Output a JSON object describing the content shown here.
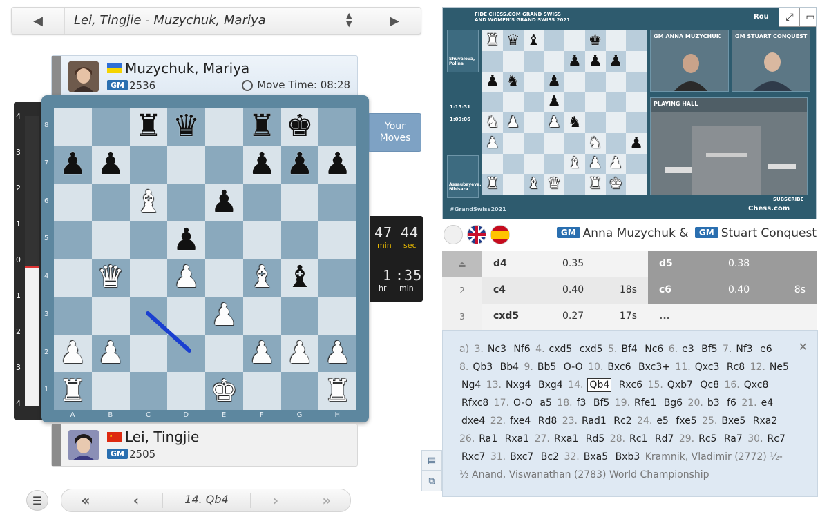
{
  "game_bar": {
    "title": "Lei, Tingjie - Muzychuk, Mariya",
    "prev_icon": "triangle-left",
    "next_icon": "triangle-right",
    "sort_icon": "updown-arrows"
  },
  "top_player": {
    "name": "Muzychuk, Mariya",
    "title": "GM",
    "rating": "2536",
    "move_time_label": "Move Time: 08:28",
    "flag": "ukraine"
  },
  "bottom_player": {
    "name": "Lei, Tingjie",
    "title": "GM",
    "rating": "2505",
    "flag": "china"
  },
  "eval_bar": {
    "ticks": [
      "4",
      "3",
      "2",
      "1",
      "0",
      "1",
      "2",
      "3",
      "4"
    ],
    "white_advantage": 0.0
  },
  "board": {
    "files": [
      "A",
      "B",
      "C",
      "D",
      "E",
      "F",
      "G",
      "H"
    ],
    "ranks": [
      "8",
      "7",
      "6",
      "5",
      "4",
      "3",
      "2",
      "1"
    ],
    "rows": [
      [
        "",
        "",
        "br",
        "bq",
        "",
        "br",
        "bk",
        ""
      ],
      [
        "bp",
        "bp",
        "",
        "",
        "",
        "bp",
        "bp",
        "bp"
      ],
      [
        "",
        "",
        "wb",
        "",
        "bp",
        "",
        "",
        ""
      ],
      [
        "",
        "",
        "",
        "bp",
        "",
        "",
        "",
        ""
      ],
      [
        "",
        "wq",
        "",
        "wp",
        "",
        "wb",
        "bb",
        ""
      ],
      [
        "",
        "",
        "",
        "",
        "wp",
        "",
        "",
        ""
      ],
      [
        "wp",
        "wp",
        "",
        "",
        "",
        "wp",
        "wp",
        "wp"
      ],
      [
        "wr",
        "",
        "",
        "",
        "wk",
        "",
        "",
        "wr"
      ]
    ]
  },
  "your_moves_label": "Your Moves",
  "timebox": {
    "min_value": "47",
    "sec_value": "44",
    "min_label": "min",
    "sec_label": "sec",
    "hr_value": "1",
    "min2_value": "35",
    "hr_label": "hr",
    "min2_label": "min"
  },
  "nav": {
    "current_move": "14. Qb4"
  },
  "video": {
    "header_line1": "FIDE CHESS.COM GRAND SWISS",
    "header_line2": "AND WOMEN'S GRAND SWISS 2021",
    "round_label": "Rou",
    "cam1_label": "GM ANNA MUZYCHUK",
    "cam2_label": "GM STUART CONQUEST",
    "hall_label": "PLAYING HALL",
    "hashtag": "#GrandSwiss2021",
    "brand": "Chess.com",
    "subscribe": "SUBSCRIBE",
    "clock1": "1:15:31",
    "clock2": "1:09:06",
    "left_player1": "Shuvalova, Polina",
    "left_player2": "Assaubayeva, Bibisara",
    "board_rows": [
      [
        "wr",
        "bq",
        "bb",
        "",
        "",
        "bk",
        "",
        ""
      ],
      [
        "",
        "",
        "",
        "",
        "bp",
        "bp",
        "bp",
        ""
      ],
      [
        "bp",
        "bn",
        "",
        "bp",
        "",
        "",
        "",
        ""
      ],
      [
        "",
        "",
        "",
        "bp",
        "",
        "",
        "",
        ""
      ],
      [
        "wn",
        "wp",
        "",
        "wp",
        "bn",
        "",
        "",
        ""
      ],
      [
        "wp",
        "",
        "",
        "",
        "",
        "wn",
        "",
        "bp"
      ],
      [
        "",
        "",
        "",
        "",
        "wb",
        "wp",
        "wp",
        ""
      ],
      [
        "wr",
        "",
        "wb",
        "wq",
        "",
        "wr",
        "wk",
        ""
      ]
    ]
  },
  "commentary": {
    "label_gm1": "GM",
    "name1": "Anna Muzychuk &",
    "label_gm2": "GM",
    "name2": "Stuart Conquest"
  },
  "moves_table": [
    {
      "num": "",
      "white": "d4",
      "white_eval": "0.35",
      "white_time": "",
      "black": "d5",
      "black_eval": "0.38",
      "black_time": ""
    },
    {
      "num": "2",
      "white": "c4",
      "white_eval": "0.40",
      "white_time": "18s",
      "black": "c6",
      "black_eval": "0.40",
      "black_time": "8s"
    },
    {
      "num": "3",
      "white": "cxd5",
      "white_eval": "0.27",
      "white_time": "17s",
      "black": "...",
      "black_eval": "",
      "black_time": ""
    }
  ],
  "variation": {
    "prefix": "a)",
    "tokens": [
      [
        "3.",
        "Nc3"
      ],
      [
        "",
        "Nf6"
      ],
      [
        "4.",
        "cxd5"
      ],
      [
        "",
        "cxd5"
      ],
      [
        "5.",
        "Bf4"
      ],
      [
        "",
        "Nc6"
      ],
      [
        "6.",
        "e3"
      ],
      [
        "",
        "Bf5"
      ],
      [
        "7.",
        "Nf3"
      ],
      [
        "",
        "e6"
      ],
      [
        "8.",
        "Qb3"
      ],
      [
        "",
        "Bb4"
      ],
      [
        "9.",
        "Bb5"
      ],
      [
        "",
        "O-O"
      ],
      [
        "10.",
        "Bxc6"
      ],
      [
        "",
        "Bxc3+"
      ],
      [
        "11.",
        "Qxc3"
      ],
      [
        "",
        "Rc8"
      ],
      [
        "12.",
        "Ne5"
      ],
      [
        "",
        "Ng4"
      ],
      [
        "13.",
        "Nxg4"
      ],
      [
        "",
        "Bxg4"
      ],
      [
        "14.",
        "Qb4"
      ],
      [
        "",
        "Rxc6"
      ],
      [
        "15.",
        "Qxb7"
      ],
      [
        "",
        "Qc8"
      ],
      [
        "16.",
        "Qxc8"
      ],
      [
        "",
        "Rfxc8"
      ],
      [
        "17.",
        "O-O"
      ],
      [
        "",
        "a5"
      ],
      [
        "18.",
        "f3"
      ],
      [
        "",
        "Bf5"
      ],
      [
        "19.",
        "Rfe1"
      ],
      [
        "",
        "Bg6"
      ],
      [
        "20.",
        "b3"
      ],
      [
        "",
        "f6"
      ],
      [
        "21.",
        "e4"
      ],
      [
        "",
        "dxe4"
      ],
      [
        "22.",
        "fxe4"
      ],
      [
        "",
        "Rd8"
      ],
      [
        "23.",
        "Rad1"
      ],
      [
        "",
        "Rc2"
      ],
      [
        "24.",
        "e5"
      ],
      [
        "",
        "fxe5"
      ],
      [
        "25.",
        "Bxe5"
      ],
      [
        "",
        "Rxa2"
      ],
      [
        "26.",
        "Ra1"
      ],
      [
        "",
        "Rxa1"
      ],
      [
        "27.",
        "Rxa1"
      ],
      [
        "",
        "Rd5"
      ],
      [
        "28.",
        "Rc1"
      ],
      [
        "",
        "Rd7"
      ],
      [
        "29.",
        "Rc5"
      ],
      [
        "",
        "Ra7"
      ],
      [
        "30.",
        "Rc7"
      ],
      [
        "",
        "Rxc7"
      ],
      [
        "31.",
        "Bxc7"
      ],
      [
        "",
        "Bc2"
      ],
      [
        "32.",
        "Bxa5"
      ],
      [
        "",
        "Bxb3"
      ]
    ],
    "current_index": 22,
    "game_meta": "Kramnik, Vladimir (2772) ½-½ Anand, Viswanathan (2783) World Championship"
  }
}
